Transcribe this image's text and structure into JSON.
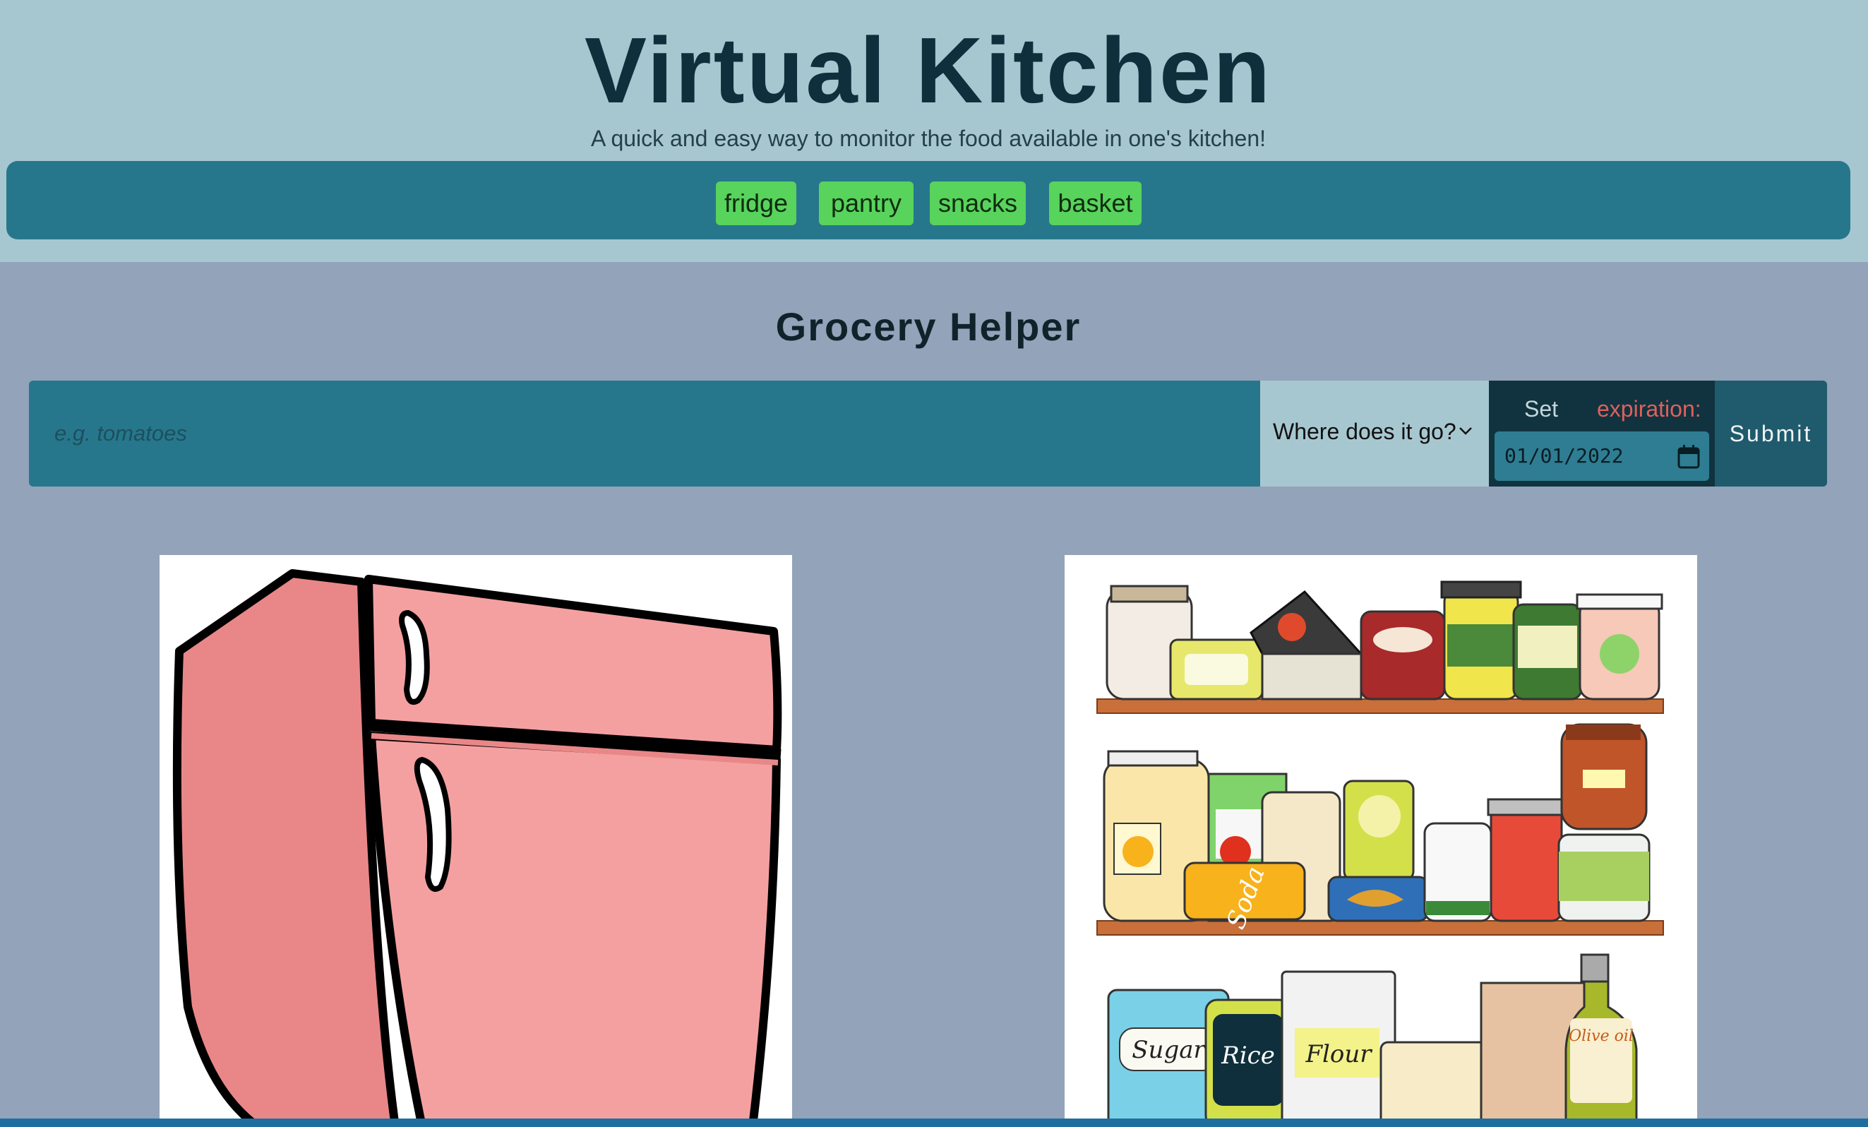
{
  "header": {
    "title": "Virtual Kitchen",
    "subtitle": "A quick and easy way to monitor the food available in one's kitchen!"
  },
  "nav": {
    "items": [
      {
        "label": "fridge"
      },
      {
        "label": "pantry"
      },
      {
        "label": "snacks"
      },
      {
        "label": "basket"
      }
    ]
  },
  "main": {
    "section_title": "Grocery Helper",
    "form": {
      "item_placeholder": "e.g. tomatoes",
      "location_select": "Where does it go?",
      "expiration_set": "Set",
      "expiration_label": "expiration:",
      "date_value": "01/01/2022",
      "submit_label": "Submit"
    }
  },
  "images": {
    "fridge": {
      "icon": "fridge-illustration"
    },
    "pantry": {
      "icon": "pantry-illustration",
      "labels": [
        "Soda",
        "Sugar",
        "Rice",
        "Flour",
        "Olive oil"
      ]
    }
  },
  "colors": {
    "header_bg": "#a7c7d0",
    "nav_bg": "#26778c",
    "nav_item_bg": "#58d35c",
    "page_bg": "#93a3b9",
    "accent_red": "#e0605d"
  }
}
